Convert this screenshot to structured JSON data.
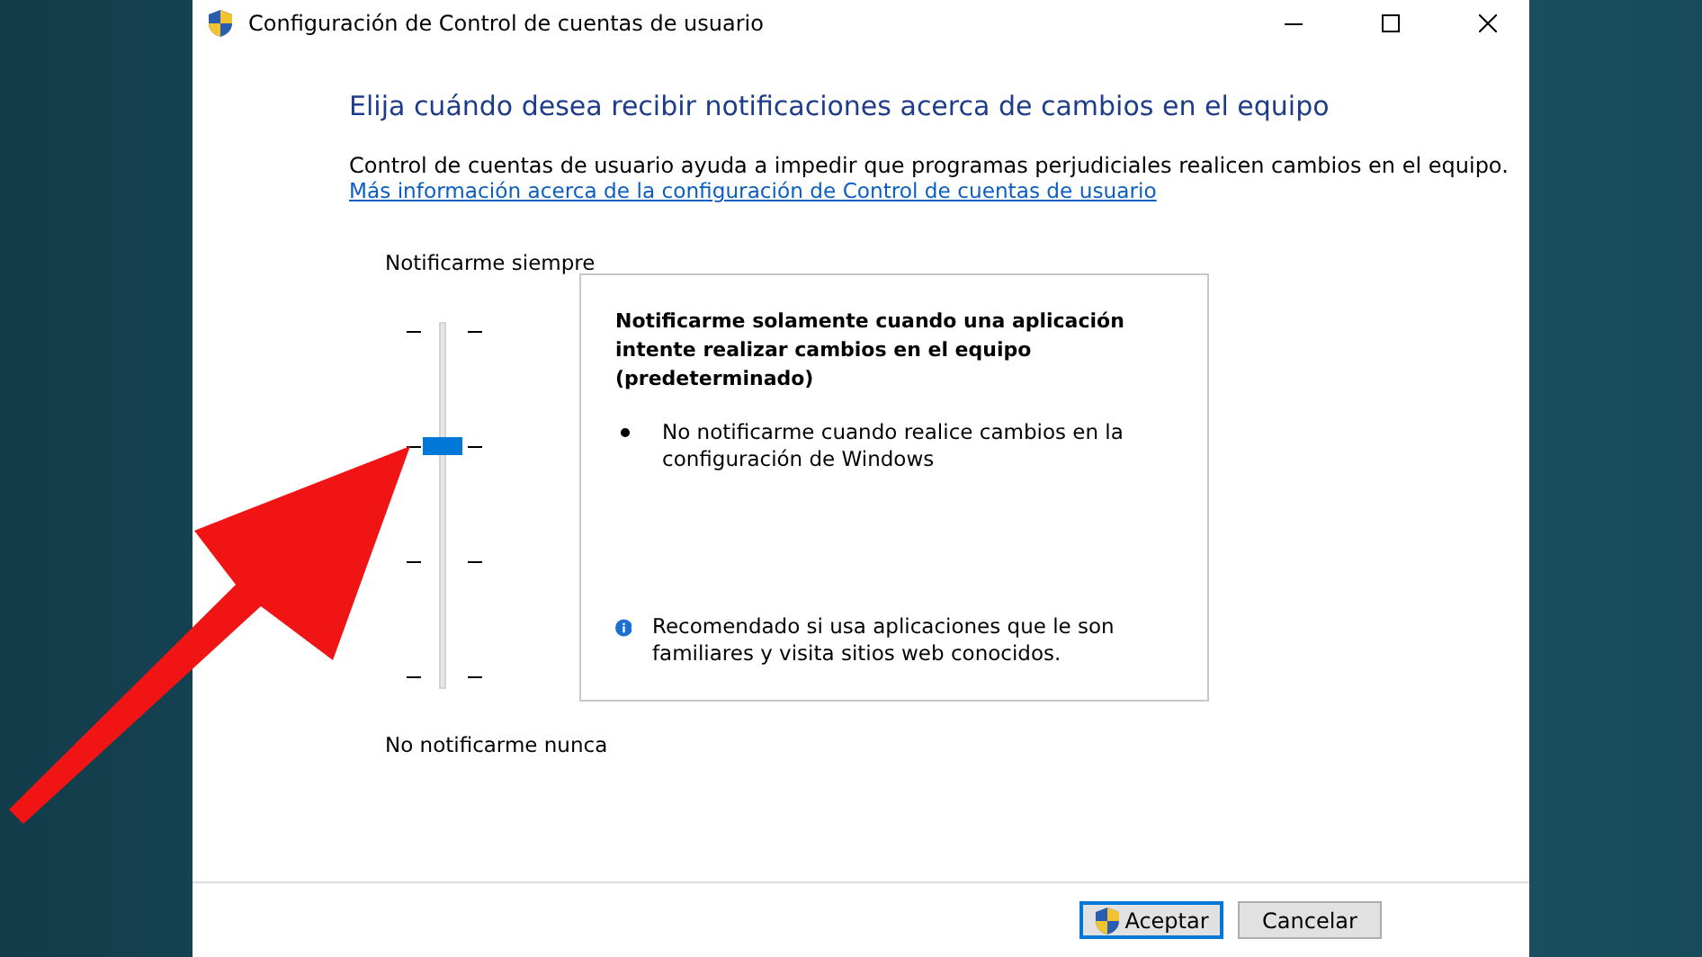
{
  "window": {
    "title": "Configuración de Control de cuentas de usuario"
  },
  "heading": "Elija cuándo desea recibir notificaciones acerca de cambios en el equipo",
  "description": "Control de cuentas de usuario ayuda a impedir que programas perjudiciales realicen cambios en el equipo.",
  "link": "Más información acerca de la configuración de Control de cuentas de usuario",
  "slider": {
    "top_label": "Notificarme siempre",
    "bottom_label": "No notificarme nunca",
    "level": 0.667
  },
  "panel": {
    "title": "Notificarme solamente cuando una aplicación intente realizar cambios en el equipo (predeterminado)",
    "bullets": [
      "No notificarme cuando realice cambios en la configuración de Windows"
    ],
    "note": "Recomendado si usa aplicaciones que le son familiares y visita sitios web conocidos."
  },
  "buttons": [
    {
      "label": "Aceptar",
      "kind": "shield",
      "default": true
    },
    {
      "label": "Cancelar",
      "kind": "plain",
      "default": false
    }
  ]
}
